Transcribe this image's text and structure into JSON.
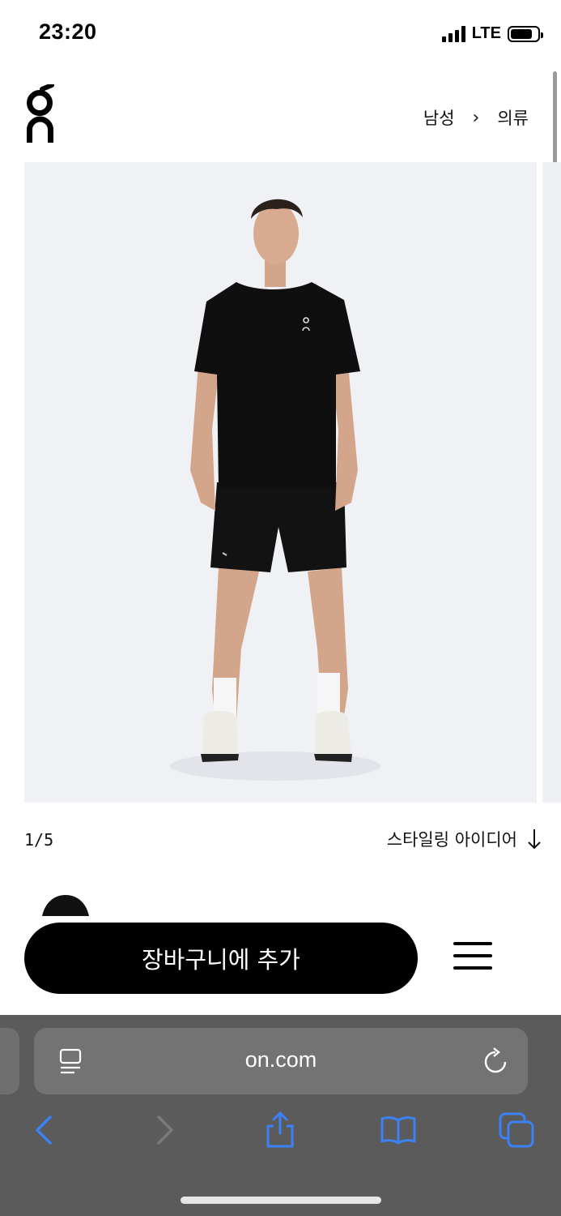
{
  "status_bar": {
    "time": "23:20",
    "network": "LTE"
  },
  "brand": {
    "logo_name": "On"
  },
  "breadcrumb": {
    "items": [
      "남성",
      "의류"
    ],
    "separator": "›"
  },
  "gallery": {
    "counter": "1/5",
    "styling_link": "스타일링 아이디어",
    "background": "#f0f1f5"
  },
  "actions": {
    "add_to_cart": "장바구니에 추가"
  },
  "browser": {
    "url": "on.com"
  },
  "colors": {
    "accent_blue": "#3b82f6",
    "toolbar_bg": "#5b5b5b",
    "button_bg": "#000000"
  },
  "icons": [
    "reader-icon",
    "reload-icon",
    "back-icon",
    "forward-icon",
    "share-icon",
    "bookmarks-icon",
    "tabs-icon",
    "menu-icon",
    "arrow-down-icon"
  ]
}
